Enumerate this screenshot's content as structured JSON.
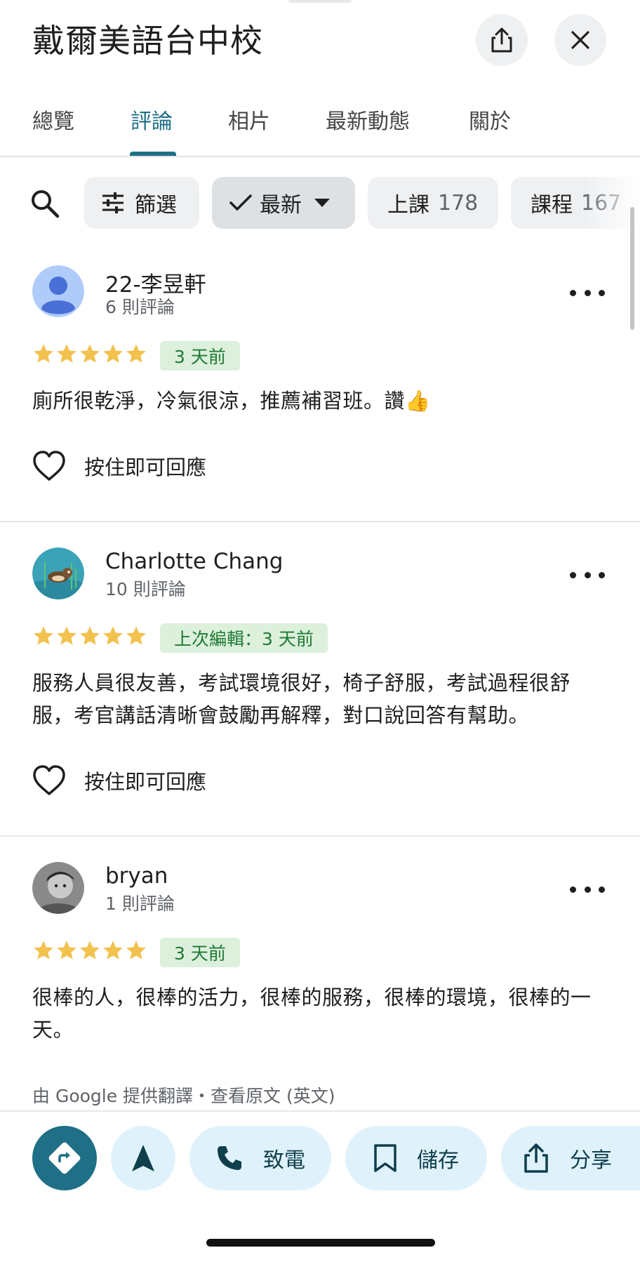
{
  "header": {
    "title": "戴爾美語台中校",
    "share_icon": "share-icon",
    "close_icon": "close-icon"
  },
  "tabs": [
    {
      "label": "總覽",
      "active": false
    },
    {
      "label": "評論",
      "active": true
    },
    {
      "label": "相片",
      "active": false
    },
    {
      "label": "最新動態",
      "active": false
    },
    {
      "label": "關於",
      "active": false
    }
  ],
  "filters": {
    "search_icon": "search-icon",
    "filter_label": "篩選",
    "sort_label": "最新",
    "topics": [
      {
        "label": "上課",
        "count": "178"
      },
      {
        "label": "課程",
        "count": "167"
      }
    ]
  },
  "reviews": [
    {
      "name": "22-李昱軒",
      "review_count": "6 則評論",
      "rating": 5,
      "date": "3 天前",
      "text": "廁所很乾淨，冷氣很涼，推薦補習班。讚👍",
      "like_label": "按住即可回應"
    },
    {
      "name": "Charlotte Chang",
      "review_count": "10 則評論",
      "rating": 5,
      "date": "上次編輯：3 天前",
      "text": "服務人員很友善，考試環境很好，椅子舒服，考試過程很舒服，考官講話清晰會鼓勵再解釋，對口說回答有幫助。",
      "like_label": "按住即可回應"
    },
    {
      "name": "bryan",
      "review_count": "1 則評論",
      "rating": 5,
      "date": "3 天前",
      "text": "很棒的人，很棒的活力，很棒的服務，很棒的環境，很棒的一天。",
      "translation_note": "由 Google 提供翻譯・查看原文 (英文)"
    }
  ],
  "actions": {
    "directions_icon": "directions-icon",
    "navigate_icon": "navigation-arrow-icon",
    "call_label": "致電",
    "save_label": "儲存",
    "share_label": "分享"
  },
  "colors": {
    "accent": "#1f6f86",
    "star": "#f2c14e",
    "date_badge_bg": "#dcf0dc",
    "date_badge_text": "#1e7a34",
    "action_bg": "#dff2fb"
  }
}
